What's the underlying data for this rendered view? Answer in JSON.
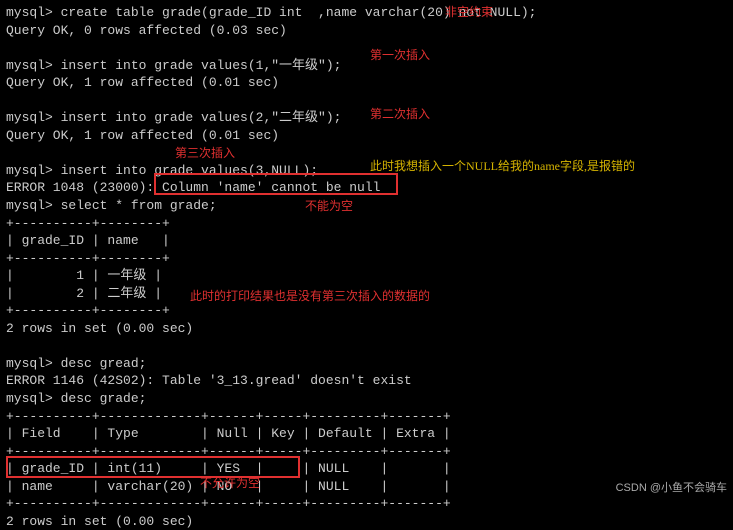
{
  "lines": {
    "l1": "mysql> create table grade(grade_ID int  ,name varchar(20) not NULL);",
    "l2": "Query OK, 0 rows affected (0.03 sec)",
    "l3": "mysql> insert into grade values(1,\"一年级\");",
    "l4": "Query OK, 1 row affected (0.01 sec)",
    "l5": "mysql> insert into grade values(2,\"二年级\");",
    "l6": "Query OK, 1 row affected (0.01 sec)",
    "l7": "mysql> insert into grade values(3,NULL);",
    "l8": "ERROR 1048 (23000): Column 'name' cannot be null",
    "l9": "mysql> select * from grade;",
    "d1": "+----------+--------+",
    "d2": "| grade_ID | name   |",
    "d3": "+----------+--------+",
    "d4": "|        1 | 一年级 |",
    "d5": "|        2 | 二年级 |",
    "d6": "+----------+--------+",
    "l10": "2 rows in set (0.00 sec)",
    "l11": "mysql> desc gread;",
    "l12": "ERROR 1146 (42S02): Table '3_13.gread' doesn't exist",
    "l13": "mysql> desc grade;",
    "t1": "+----------+-------------+------+-----+---------+-------+",
    "t2": "| Field    | Type        | Null | Key | Default | Extra |",
    "t3": "+----------+-------------+------+-----+---------+-------+",
    "t4": "| grade_ID | int(11)     | YES  |     | NULL    |       |",
    "t5": "| name     | varchar(20) | NO   |     | NULL    |       |",
    "t6": "+----------+-------------+------+-----+---------+-------+",
    "l14": "2 rows in set (0.00 sec)"
  },
  "annotations": {
    "a1": "非空约束",
    "a2": "第一次插入",
    "a3": "第二次插入",
    "a4": "第三次插入",
    "a5": "此时我想插入一个NULL给我的name字段,是报错的",
    "a6": "不能为空",
    "a7": "此时的打印结果也是没有第三次插入的数据的",
    "a8": "不允许为空"
  },
  "watermark": "CSDN @小鱼不会骑车"
}
